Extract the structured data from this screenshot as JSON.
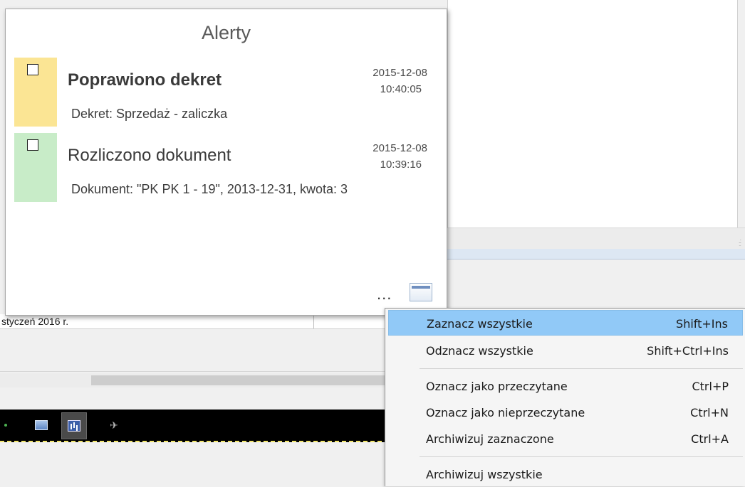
{
  "background": {
    "status_text": "styczeń 2016 r."
  },
  "alerts": {
    "title": "Alerty",
    "items": [
      {
        "heading": "Poprawiono dekret",
        "date": "2015-12-08",
        "time": "10:40:05",
        "description": "Dekret: Sprzedaż - zaliczka",
        "color": "#fbe594",
        "read": false
      },
      {
        "heading": "Rozliczono dokument",
        "date": "2015-12-08",
        "time": "10:39:16",
        "description": "Dokument: \"PK PK 1 - 19\", 2013-12-31, kwota: 3",
        "color": "#c8ecc8",
        "read": true
      }
    ],
    "more_label": "...",
    "icon": "window-icon"
  },
  "context_menu": {
    "items": [
      {
        "label": "Zaznacz wszystkie",
        "shortcut": "Shift+Ins",
        "highlighted": true
      },
      {
        "label": "Odznacz wszystkie",
        "shortcut": "Shift+Ctrl+Ins"
      },
      {
        "label": "Oznacz jako przeczytane",
        "shortcut": "Ctrl+P"
      },
      {
        "label": "Oznacz jako nieprzeczytane",
        "shortcut": "Ctrl+N"
      },
      {
        "label": "Archiwizuj zaznaczone",
        "shortcut": "Ctrl+A"
      },
      {
        "label": "Archiwizuj wszystkie",
        "shortcut": ""
      }
    ],
    "highlight_color": "#91c9f7"
  },
  "taskbar": {
    "icons": [
      "monitor-icon",
      "chart-icon",
      "satellite-icon"
    ]
  }
}
